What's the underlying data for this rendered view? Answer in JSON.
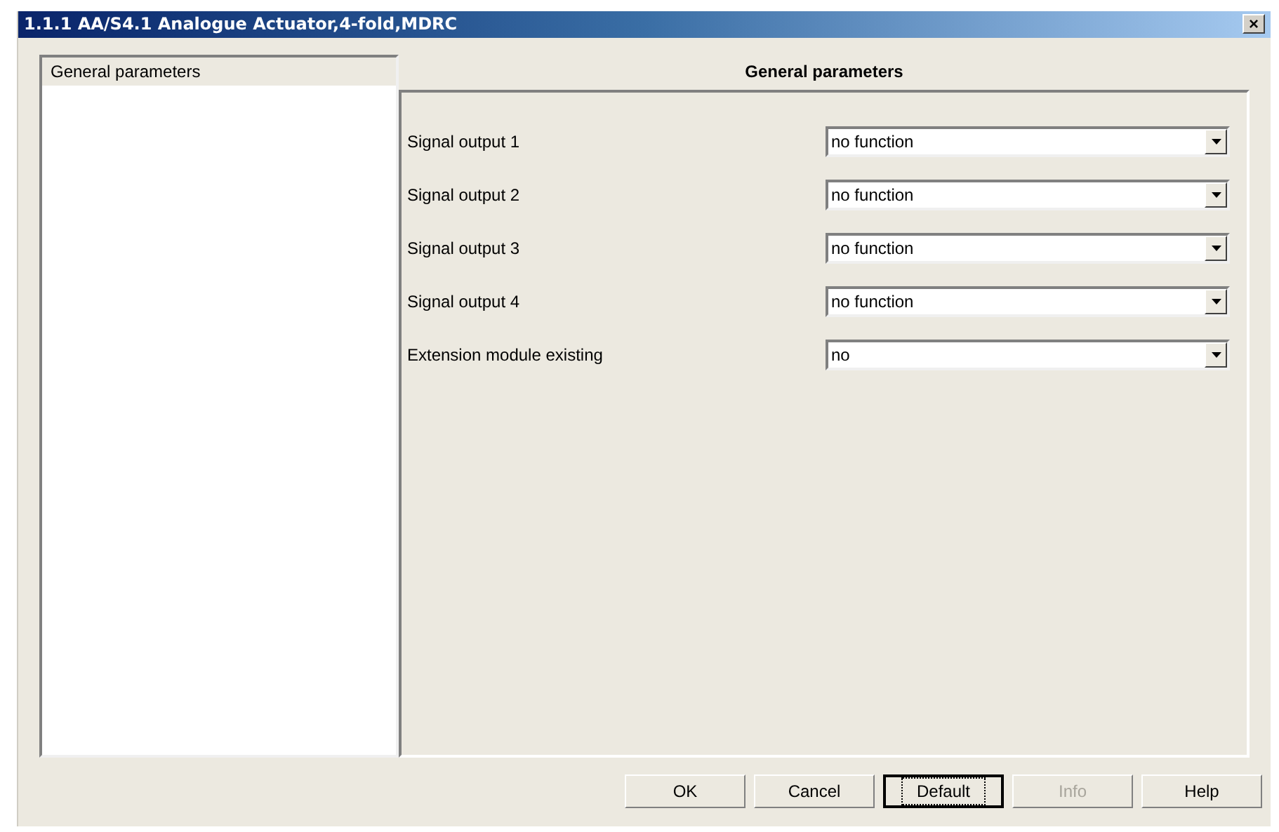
{
  "window": {
    "title": "1.1.1 AA/S4.1 Analogue Actuator,4-fold,MDRC",
    "close": "×"
  },
  "sidebar": {
    "items": [
      {
        "label": "General parameters",
        "selected": true
      }
    ]
  },
  "panel": {
    "title": "General parameters",
    "rows": [
      {
        "label": "Signal output 1",
        "value": "no function"
      },
      {
        "label": "Signal output 2",
        "value": "no function"
      },
      {
        "label": "Signal output 3",
        "value": "no function"
      },
      {
        "label": "Signal output 4",
        "value": "no function"
      },
      {
        "label": "Extension module existing",
        "value": "no"
      }
    ]
  },
  "buttons": [
    {
      "label": "OK",
      "disabled": false,
      "focused": false
    },
    {
      "label": "Cancel",
      "disabled": false,
      "focused": false
    },
    {
      "label": "Default",
      "disabled": false,
      "focused": true
    },
    {
      "label": "Info",
      "disabled": true,
      "focused": false
    },
    {
      "label": "Help",
      "disabled": false,
      "focused": false
    }
  ]
}
